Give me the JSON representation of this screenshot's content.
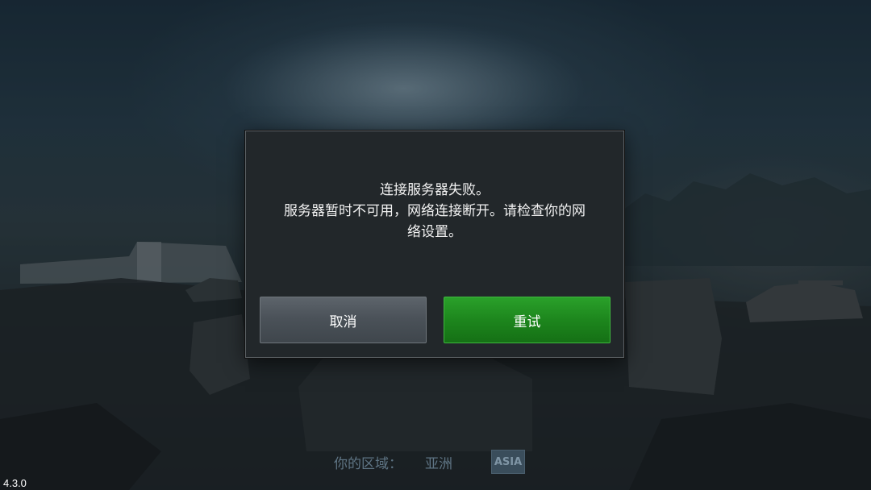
{
  "dialog": {
    "message_lines": [
      "连接服务器失败。",
      "服务器暂时不可用，网络连接断开。请检查你的网",
      "络设置。"
    ],
    "cancel_label": "取消",
    "retry_label": "重试"
  },
  "region": {
    "label": "你的区域：",
    "value": "亚洲",
    "badge": "ASIA"
  },
  "version": "4.3.0"
}
